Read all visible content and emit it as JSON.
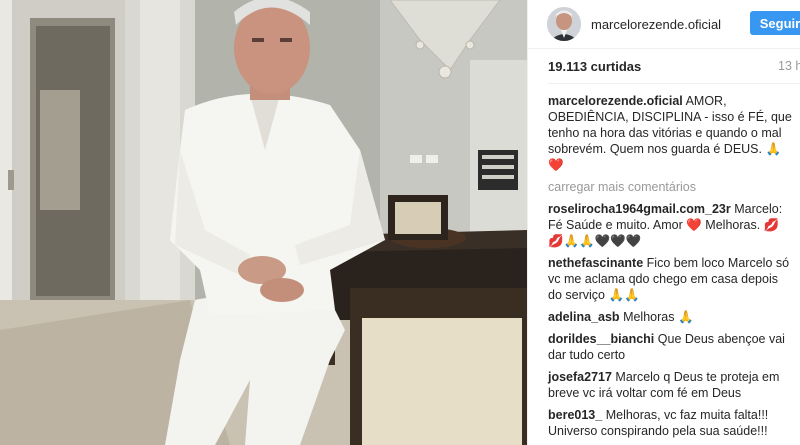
{
  "header": {
    "username": "marcelorezende.oficial",
    "follow_label": "Seguir"
  },
  "stats": {
    "likes": "19.113 curtidas",
    "time": "13 h"
  },
  "caption": {
    "username": "marcelorezende.oficial",
    "text": "AMOR, OBEDIÊNCIA, DISCIPLINA - isso é FÉ, que tenho na hora das vitórias e quando o mal sobrevém. Quem nos guarda é DEUS.",
    "emoji": "🙏❤️"
  },
  "load_more": "carregar mais comentários",
  "comments": [
    {
      "username": "roselirocha1964gmail.com_23r",
      "text": "Marcelo: Fé Saúde e muito. Amor ❤️ Melhoras. 💋💋🙏🙏🖤🖤🖤"
    },
    {
      "username": "nethefascinante",
      "text": "Fico bem loco Marcelo só vc me aclama qdo chego em casa depois do serviço 🙏🙏"
    },
    {
      "username": "adelina_asb",
      "text": "Melhoras 🙏"
    },
    {
      "username": "dorildes__bianchi",
      "text": "Que Deus abençoe vai dar tudo certo"
    },
    {
      "username": "josefa2717",
      "text": "Marcelo q Deus te proteja em breve vc irá voltar com fé em Deus"
    },
    {
      "username": "bere013_",
      "text": "Melhoras, vc faz muita falta!!! Universo conspirando pela sua saúde!!!"
    }
  ]
}
